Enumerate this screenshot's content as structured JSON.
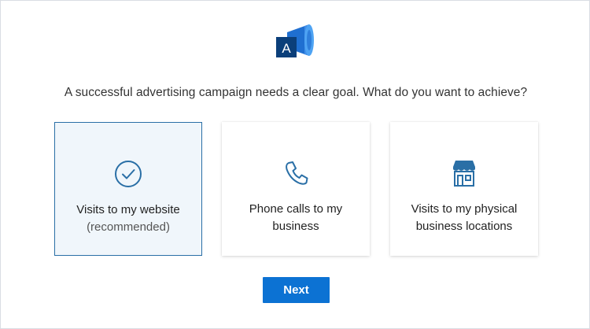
{
  "logo": {
    "letter": "A",
    "icon": "megaphone-logo-icon",
    "colors": {
      "dark": "#0b3f7a",
      "mid": "#1f6fd1",
      "light": "#4ea3f3"
    }
  },
  "headline": "A successful advertising campaign needs a clear goal. What do you want to achieve?",
  "options": [
    {
      "label": "Visits to my website",
      "sublabel": "(recommended)",
      "icon": "check-circle-icon",
      "selected": true
    },
    {
      "label": "Phone calls to my business",
      "icon": "phone-icon",
      "selected": false
    },
    {
      "label": "Visits to my physical business locations",
      "icon": "storefront-icon",
      "selected": false
    }
  ],
  "next_button": {
    "label": "Next"
  },
  "colors": {
    "accent": "#0c72d3",
    "icon": "#2a6fa6",
    "selected_border": "#2a6fa6",
    "selected_bg": "#f0f6fb"
  }
}
